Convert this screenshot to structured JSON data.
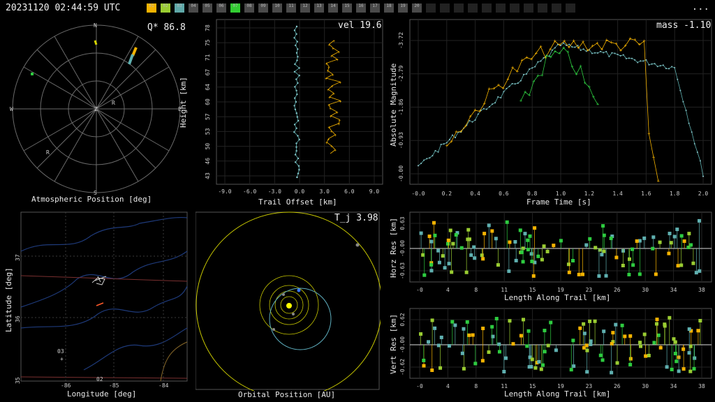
{
  "header": {
    "timestamp": "20231120 02:44:59 UTC",
    "menu_label": "...",
    "stations": [
      {
        "id": "01",
        "color": "#f5b301"
      },
      {
        "id": "02",
        "color": "#9acd32"
      },
      {
        "id": "03",
        "color": "#5fa8a8"
      },
      {
        "id": "04",
        "color": "#4a4a4a"
      },
      {
        "id": "05",
        "color": "#4a4a4a"
      },
      {
        "id": "06",
        "color": "#4a4a4a"
      },
      {
        "id": "07",
        "color": "#32cd32"
      },
      {
        "id": "08",
        "color": "#4a4a4a"
      },
      {
        "id": "09",
        "color": "#4a4a4a"
      },
      {
        "id": "10",
        "color": "#4a4a4a"
      },
      {
        "id": "11",
        "color": "#4a4a4a"
      },
      {
        "id": "12",
        "color": "#4a4a4a"
      },
      {
        "id": "13",
        "color": "#4a4a4a"
      },
      {
        "id": "14",
        "color": "#4a4a4a"
      },
      {
        "id": "15",
        "color": "#4a4a4a"
      },
      {
        "id": "16",
        "color": "#4a4a4a"
      },
      {
        "id": "17",
        "color": "#4a4a4a"
      },
      {
        "id": "18",
        "color": "#4a4a4a"
      },
      {
        "id": "19",
        "color": "#4a4a4a"
      },
      {
        "id": "20",
        "color": "#4a4a4a"
      },
      {
        "id": "",
        "color": "#222"
      },
      {
        "id": "",
        "color": "#222"
      },
      {
        "id": "",
        "color": "#222"
      },
      {
        "id": "",
        "color": "#222"
      },
      {
        "id": "",
        "color": "#222"
      },
      {
        "id": "",
        "color": "#222"
      },
      {
        "id": "",
        "color": "#222"
      },
      {
        "id": "",
        "color": "#222"
      },
      {
        "id": "",
        "color": "#222"
      },
      {
        "id": "",
        "color": "#222"
      },
      {
        "id": "",
        "color": "#222"
      }
    ]
  },
  "polar": {
    "stat": "Q* 86.8",
    "label": "Atmospheric Position [deg]",
    "dirs": {
      "n": "N",
      "s": "S",
      "e": "E",
      "w": "W",
      "z": "Z"
    },
    "markers": [
      "R",
      "R"
    ]
  },
  "height_plot": {
    "stat": "vel 19.6",
    "xlabel": "Trail Offset [km]",
    "ylabel": "Height [km]",
    "xticks": [
      "-9.0",
      "-6.0",
      "-3.0",
      "0.0",
      "3.0",
      "6.0",
      "9.0"
    ],
    "yticks": [
      "78",
      "75",
      "71",
      "67",
      "64",
      "60",
      "57",
      "53",
      "50",
      "46",
      "43"
    ]
  },
  "mag_plot": {
    "stat": "mass -1.10",
    "xlabel": "Frame Time [s]",
    "ylabel": "Absolute Magnitude",
    "xticks": [
      "-0.0",
      "0.2",
      "0.4",
      "0.6",
      "0.8",
      "1.0",
      "1.2",
      "1.4",
      "1.6",
      "1.8",
      "2.0"
    ],
    "yticks": [
      "-3.72",
      "-2.79",
      "-1.86",
      "-0.93",
      "-0.00"
    ]
  },
  "map": {
    "xlabel": "Longitude [deg]",
    "ylabel": "Latitude [deg]",
    "xticks": [
      "-86",
      "-85",
      "-84"
    ],
    "yticks": [
      "37",
      "36",
      "35"
    ],
    "station_labels": [
      "03",
      "02"
    ]
  },
  "orbit": {
    "stat": "T_j 3.98",
    "label": "Orbital Position [AU]"
  },
  "horz_res": {
    "xlabel": "Length Along Trail [km]",
    "ylabel": "Horz Res [km]",
    "yticks": [
      "0.63",
      "-0.00",
      "-0.63"
    ],
    "xticks": [
      "-0",
      "4",
      "8",
      "11",
      "15",
      "19",
      "23",
      "26",
      "30",
      "34",
      "38"
    ]
  },
  "vert_res": {
    "xlabel": "Length Along Trail [km]",
    "ylabel": "Vert Res [km]",
    "yticks": [
      "0.62",
      "-0.00",
      "-0.62"
    ],
    "xticks": [
      "-0",
      "4",
      "8",
      "11",
      "15",
      "19",
      "23",
      "26",
      "30",
      "34",
      "38"
    ]
  },
  "colors": {
    "orange": "#f5b301",
    "green": "#2ecc40",
    "lime": "#9acd32",
    "teal": "#5fb0b0",
    "light": "#b0e0e6",
    "grid": "#2a2a2a",
    "axis": "#777"
  }
}
